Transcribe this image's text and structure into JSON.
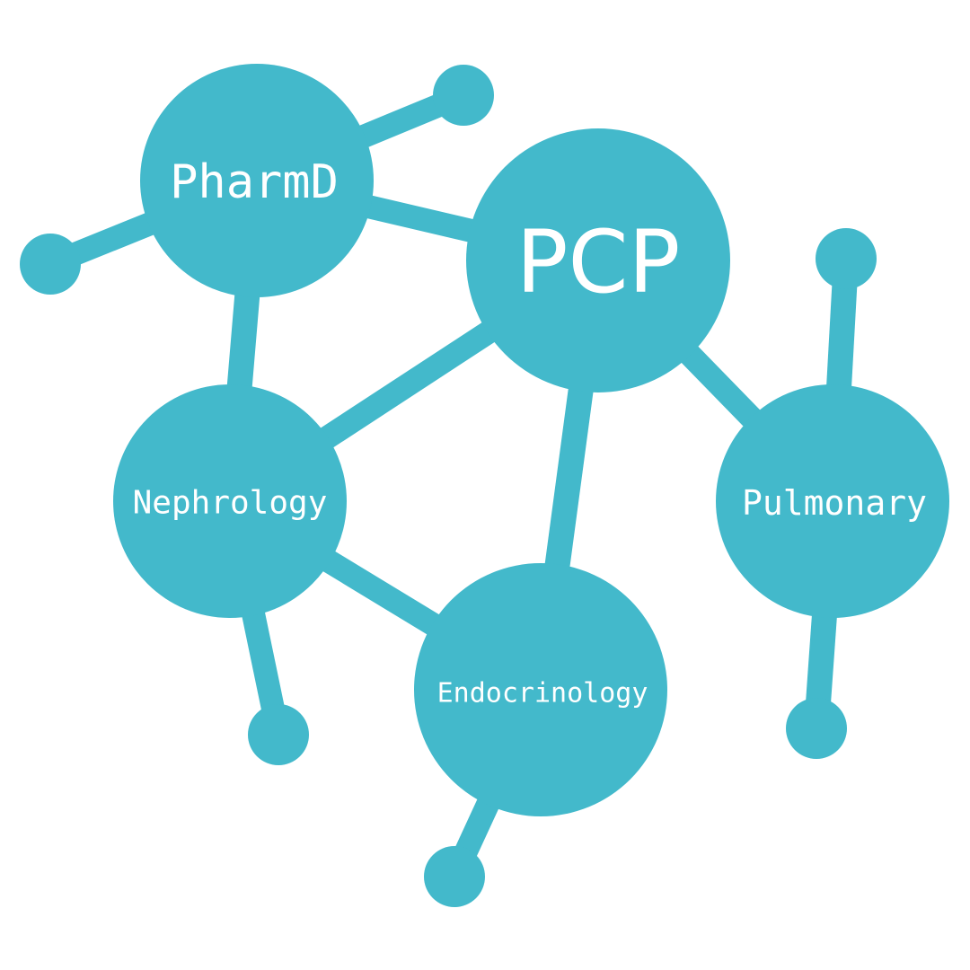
{
  "diagram": {
    "color": "#43b9cb",
    "background": "#ffffff",
    "nodes": {
      "pcp": {
        "label": "PCP"
      },
      "pharmd": {
        "label": "PharmD"
      },
      "nephrology": {
        "label": "Nephrology"
      },
      "pulmonary": {
        "label": "Pulmonary"
      },
      "endocrinology": {
        "label": "Endocrinology"
      }
    },
    "links": [
      [
        "pcp",
        "pharmd"
      ],
      [
        "pcp",
        "nephrology"
      ],
      [
        "pcp",
        "endocrinology"
      ],
      [
        "pcp",
        "pulmonary"
      ],
      [
        "pharmd",
        "nephrology"
      ],
      [
        "nephrology",
        "endocrinology"
      ]
    ]
  }
}
